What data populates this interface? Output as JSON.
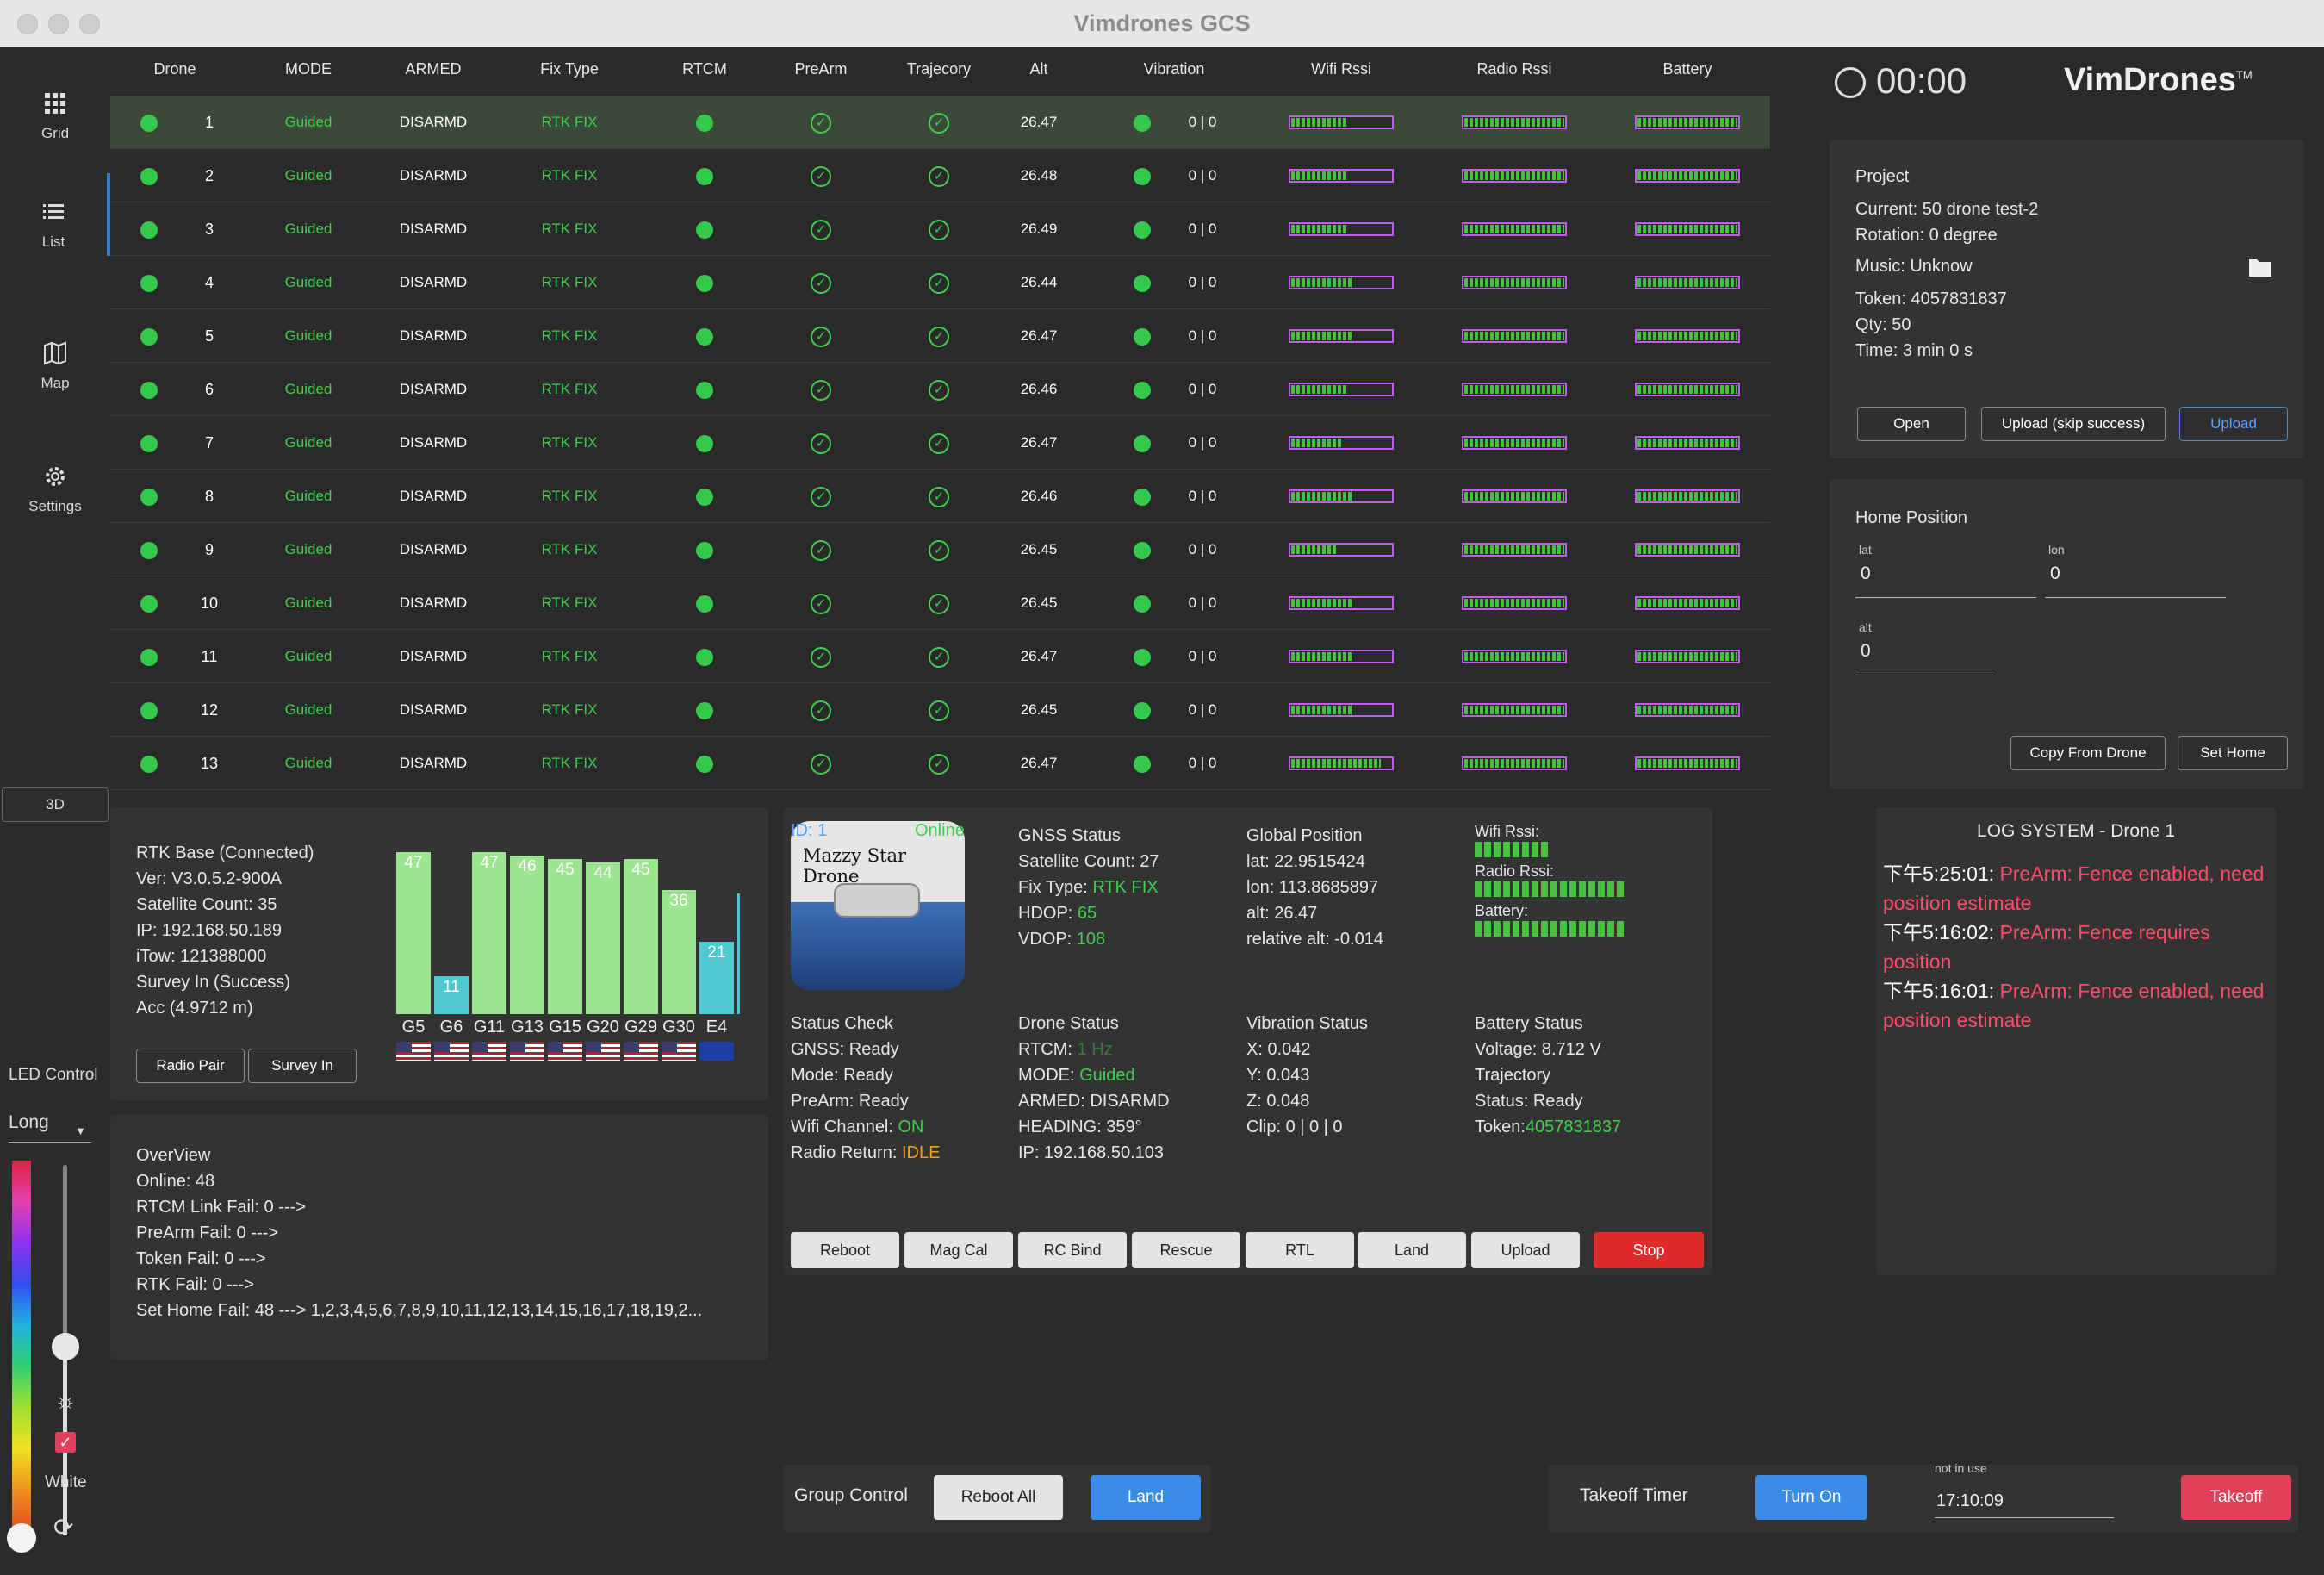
{
  "window": {
    "title": "Vimdrones GCS"
  },
  "nav": {
    "items": [
      {
        "label": "Grid"
      },
      {
        "label": "List"
      },
      {
        "label": "Map"
      },
      {
        "label": "Settings"
      }
    ],
    "btn3d": "3D"
  },
  "led": {
    "title": "LED Control",
    "mode": "Long",
    "white_label": "White"
  },
  "table": {
    "headers": [
      "Drone",
      "MODE",
      "ARMED",
      "Fix Type",
      "RTCM",
      "PreArm",
      "Trajecory",
      "Alt",
      "Vibration",
      "Wifi Rssi",
      "Radio Rssi",
      "Battery"
    ],
    "rows": [
      {
        "id": "1",
        "mode": "Guided",
        "armed": "DISARMD",
        "fix": "RTK FIX",
        "alt": "26.47",
        "vib": "0 | 0",
        "wifi": 0.55,
        "radio": 1.0,
        "battery": 1.0
      },
      {
        "id": "2",
        "mode": "Guided",
        "armed": "DISARMD",
        "fix": "RTK FIX",
        "alt": "26.48",
        "vib": "0 | 0",
        "wifi": 0.55,
        "radio": 1.0,
        "battery": 1.0
      },
      {
        "id": "3",
        "mode": "Guided",
        "armed": "DISARMD",
        "fix": "RTK FIX",
        "alt": "26.49",
        "vib": "0 | 0",
        "wifi": 0.55,
        "radio": 1.0,
        "battery": 1.0
      },
      {
        "id": "4",
        "mode": "Guided",
        "armed": "DISARMD",
        "fix": "RTK FIX",
        "alt": "26.44",
        "vib": "0 | 0",
        "wifi": 0.6,
        "radio": 1.0,
        "battery": 1.0
      },
      {
        "id": "5",
        "mode": "Guided",
        "armed": "DISARMD",
        "fix": "RTK FIX",
        "alt": "26.47",
        "vib": "0 | 0",
        "wifi": 0.6,
        "radio": 1.0,
        "battery": 1.0
      },
      {
        "id": "6",
        "mode": "Guided",
        "armed": "DISARMD",
        "fix": "RTK FIX",
        "alt": "26.46",
        "vib": "0 | 0",
        "wifi": 0.55,
        "radio": 1.0,
        "battery": 1.0
      },
      {
        "id": "7",
        "mode": "Guided",
        "armed": "DISARMD",
        "fix": "RTK FIX",
        "alt": "26.47",
        "vib": "0 | 0",
        "wifi": 0.5,
        "radio": 1.0,
        "battery": 1.0
      },
      {
        "id": "8",
        "mode": "Guided",
        "armed": "DISARMD",
        "fix": "RTK FIX",
        "alt": "26.46",
        "vib": "0 | 0",
        "wifi": 0.6,
        "radio": 1.0,
        "battery": 1.0
      },
      {
        "id": "9",
        "mode": "Guided",
        "armed": "DISARMD",
        "fix": "RTK FIX",
        "alt": "26.45",
        "vib": "0 | 0",
        "wifi": 0.45,
        "radio": 1.0,
        "battery": 1.0
      },
      {
        "id": "10",
        "mode": "Guided",
        "armed": "DISARMD",
        "fix": "RTK FIX",
        "alt": "26.45",
        "vib": "0 | 0",
        "wifi": 0.6,
        "radio": 1.0,
        "battery": 1.0
      },
      {
        "id": "11",
        "mode": "Guided",
        "armed": "DISARMD",
        "fix": "RTK FIX",
        "alt": "26.47",
        "vib": "0 | 0",
        "wifi": 0.6,
        "radio": 1.0,
        "battery": 1.0
      },
      {
        "id": "12",
        "mode": "Guided",
        "armed": "DISARMD",
        "fix": "RTK FIX",
        "alt": "26.45",
        "vib": "0 | 0",
        "wifi": 0.6,
        "radio": 1.0,
        "battery": 1.0
      },
      {
        "id": "13",
        "mode": "Guided",
        "armed": "DISARMD",
        "fix": "RTK FIX",
        "alt": "26.47",
        "vib": "0 | 0",
        "wifi": 0.9,
        "radio": 1.0,
        "battery": 1.0
      }
    ]
  },
  "timer": {
    "value": "00:00"
  },
  "logo": {
    "text": "VimDrones",
    "tm": "TM"
  },
  "project": {
    "title": "Project",
    "current": "Current: 50 drone test-2",
    "rotation": "Rotation: 0 degree",
    "music": "Music: Unknow",
    "token": "Token: 4057831837",
    "qty": "Qty: 50",
    "time": "Time: 3 min 0 s",
    "btn_open": "Open",
    "btn_upload_skip": "Upload (skip success)",
    "btn_upload": "Upload"
  },
  "home": {
    "title": "Home Position",
    "lat_label": "lat",
    "lat": "0",
    "lon_label": "lon",
    "lon": "0",
    "alt_label": "alt",
    "alt": "0",
    "btn_copy": "Copy From Drone",
    "btn_set": "Set Home"
  },
  "rtk": {
    "lines": [
      "RTK Base (Connected)",
      "Ver: V3.0.5.2-900A",
      "Satellite Count: 35",
      "IP: 192.168.50.189",
      "iTow: 121388000",
      "Survey In (Success)",
      "Acc (4.9712 m)"
    ],
    "btn_pair": "Radio Pair",
    "btn_survey": "Survey In",
    "sats": [
      {
        "id": "G5",
        "snr": 47,
        "flag": "us"
      },
      {
        "id": "G6",
        "snr": 11,
        "flag": "us"
      },
      {
        "id": "G11",
        "snr": 47,
        "flag": "us"
      },
      {
        "id": "G13",
        "snr": 46,
        "flag": "us"
      },
      {
        "id": "G15",
        "snr": 45,
        "flag": "us"
      },
      {
        "id": "G20",
        "snr": 44,
        "flag": "us"
      },
      {
        "id": "G29",
        "snr": 45,
        "flag": "us"
      },
      {
        "id": "G30",
        "snr": 36,
        "flag": "us"
      },
      {
        "id": "E4",
        "snr": 21,
        "flag": "eu"
      }
    ]
  },
  "overview": {
    "title": "OverView",
    "online": "Online: 48",
    "rtcm": "RTCM Link Fail: 0 --->",
    "prearm": "PreArm Fail: 0 --->",
    "token": "Token Fail: 0 --->",
    "rtk": "RTK Fail: 0 --->",
    "sethome": "Set Home Fail: 48 ---> 1,2,3,4,5,6,7,8,9,10,11,12,13,14,15,16,17,18,19,2..."
  },
  "drone": {
    "id": "ID: 1",
    "online": "Online",
    "name": "Mazzy Star Drone",
    "gnss": {
      "title": "GNSS Status",
      "sat": "Satellite Count: 27",
      "fix_label": "Fix Type: ",
      "fix": "RTK FIX",
      "hdop_label": "HDOP: ",
      "hdop": "65",
      "vdop_label": "VDOP: ",
      "vdop": "108"
    },
    "global": {
      "title": "Global Position",
      "lat": "lat: 22.9515424",
      "lon": "lon: 113.8685897",
      "alt": "alt: 26.47",
      "rel": "relative alt: -0.014"
    },
    "rssi": {
      "wifi": "Wifi Rssi:",
      "radio": "Radio Rssi:",
      "battery": "Battery:",
      "wifi_level": 0.5,
      "radio_level": 1.0,
      "battery_level": 1.0
    },
    "status": {
      "title": "Status Check",
      "gnss": "GNSS: Ready",
      "mode": "Mode: Ready",
      "prearm": "PreArm: Ready",
      "wifi_label": "Wifi Channel: ",
      "wifi": "ON",
      "radio_label": "Radio Return: ",
      "radio": "IDLE"
    },
    "dstatus": {
      "title": "Drone Status",
      "rtcm_label": "RTCM: ",
      "rtcm": "1 Hz",
      "mode_label": "MODE: ",
      "mode": "Guided",
      "armed": "ARMED: DISARMD",
      "heading": "HEADING: 359°",
      "ip": "IP: 192.168.50.103"
    },
    "vib": {
      "title": "Vibration Status",
      "x": "X: 0.042",
      "y": "Y: 0.043",
      "z": "Z: 0.048",
      "clip": "Clip: 0 | 0 | 0"
    },
    "battery": {
      "title": "Battery Status",
      "voltage": "Voltage: 8.712 V",
      "traj": "Trajectory",
      "status": "Status: Ready",
      "token_label": "Token:",
      "token": "4057831837"
    },
    "actions": [
      "Reboot",
      "Mag Cal",
      "RC Bind",
      "Rescue",
      "RTL",
      "Land",
      "Upload",
      "Stop"
    ]
  },
  "log": {
    "title": "LOG SYSTEM - Drone 1",
    "entries": [
      {
        "time": "下午5:25:01: ",
        "msg": "PreArm: Fence enabled, need position estimate"
      },
      {
        "time": "下午5:16:02: ",
        "msg": "PreArm: Fence requires position"
      },
      {
        "time": "下午5:16:01: ",
        "msg": "PreArm: Fence enabled, need position estimate"
      }
    ]
  },
  "group": {
    "title": "Group Control",
    "reboot_all": "Reboot All",
    "land": "Land"
  },
  "takeoff": {
    "title": "Takeoff Timer",
    "turn_on": "Turn On",
    "hint": "not in use",
    "time": "17:10:09",
    "takeoff": "Takeoff"
  },
  "colors": {
    "accent": "#2f7dd8",
    "ok": "#3fd04e",
    "alert": "#e0405a",
    "warn": "#f0a020",
    "rssi_border": "#c05cf0"
  }
}
